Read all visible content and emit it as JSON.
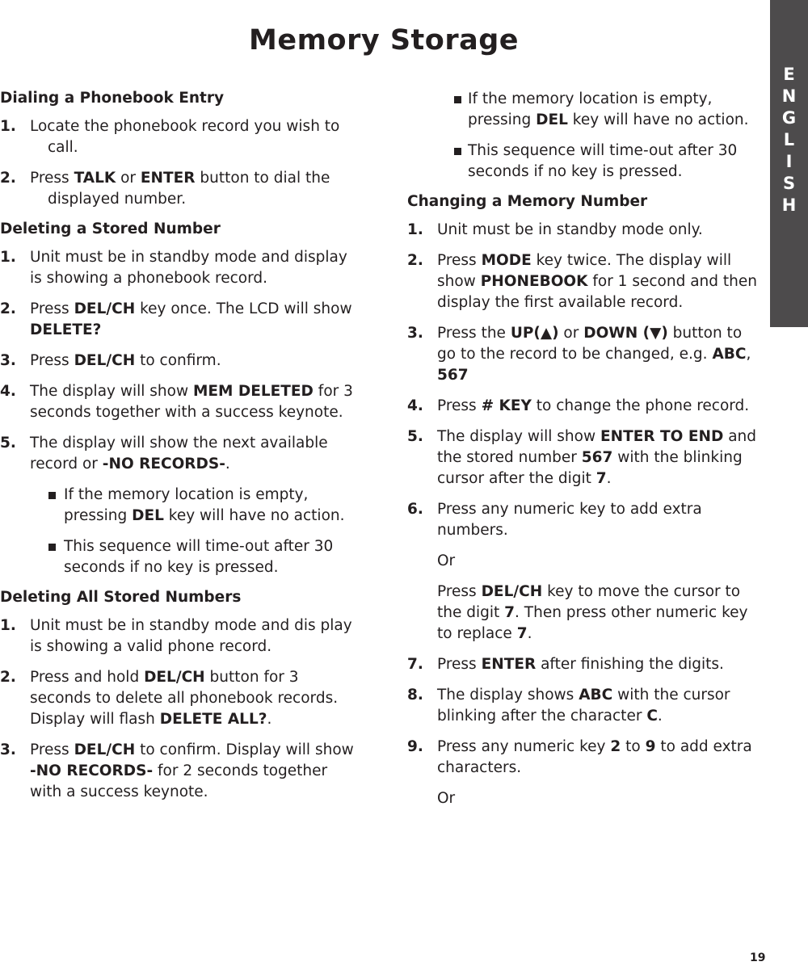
{
  "page": {
    "title": "Memory Storage",
    "page_number": "19",
    "language_tab": [
      "E",
      "N",
      "G",
      "L",
      "I",
      "S",
      "H"
    ],
    "colors": {
      "text": "#231f20",
      "tab_background": "#4d4b4c",
      "tab_text": "#ffffff"
    }
  },
  "left": {
    "dialing": {
      "heading": "Dialing a Phonebook Entry",
      "steps": [
        {
          "num": "1.",
          "segments": [
            [
              "Locate the phonebook record you wish to ",
              false
            ]
          ],
          "hang": [
            [
              "call.",
              false
            ]
          ]
        },
        {
          "num": "2.",
          "segments": [
            [
              "Press ",
              false
            ],
            [
              "TALK",
              true
            ],
            [
              " or ",
              false
            ],
            [
              "ENTER",
              true
            ],
            [
              " button to dial the",
              false
            ]
          ],
          "hang": [
            [
              "displayed number.",
              false
            ]
          ]
        }
      ]
    },
    "deleting": {
      "heading": "Deleting a Stored Number",
      "steps": [
        {
          "num": "1.",
          "segments": [
            [
              "Unit must be in standby mode and display is showing a phonebook record.",
              false
            ]
          ]
        },
        {
          "num": "2.",
          "segments": [
            [
              "Press ",
              false
            ],
            [
              "DEL/CH",
              true
            ],
            [
              " key once. The LCD will show ",
              false
            ],
            [
              "DELETE?",
              true
            ]
          ]
        },
        {
          "num": "3.",
          "segments": [
            [
              "Press ",
              false
            ],
            [
              "DEL/CH",
              true
            ],
            [
              " to confirm.",
              false
            ]
          ]
        },
        {
          "num": "4.",
          "segments": [
            [
              "The display will show ",
              false
            ],
            [
              "MEM DELETED",
              true
            ],
            [
              " for 3  seconds together with a success keynote.",
              false
            ]
          ]
        },
        {
          "num": "5.",
          "segments": [
            [
              "The display will show the next available record or ",
              false
            ],
            [
              "-NO RECORDS-",
              true
            ],
            [
              ".",
              false
            ]
          ]
        }
      ],
      "bullets": [
        {
          "segments": [
            [
              "If the memory location is empty, pressing ",
              false
            ],
            [
              "DEL",
              true
            ],
            [
              " key will have no action.",
              false
            ]
          ]
        },
        {
          "segments": [
            [
              "This sequence will time-out after 30 seconds if no key is pressed.",
              false
            ]
          ]
        }
      ]
    },
    "deleting_all": {
      "heading": "Deleting All Stored Numbers",
      "steps": [
        {
          "num": "1.",
          "segments": [
            [
              "Unit must be in standby mode and dis play is showing a valid phone record.",
              false
            ]
          ]
        },
        {
          "num": "2.",
          "segments": [
            [
              "Press and hold ",
              false
            ],
            [
              "DEL/CH",
              true
            ],
            [
              " button for 3 seconds to delete all phonebook records. Display will flash ",
              false
            ],
            [
              "DELETE ALL?",
              true
            ],
            [
              ".",
              false
            ]
          ]
        },
        {
          "num": "3.",
          "segments": [
            [
              "Press ",
              false
            ],
            [
              "DEL/CH",
              true
            ],
            [
              " to confirm. Display will show ",
              false
            ],
            [
              "-NO RECORDS-",
              true
            ],
            [
              " for 2 seconds together with a success keynote.",
              false
            ]
          ]
        }
      ]
    }
  },
  "right": {
    "bullets": [
      {
        "segments": [
          [
            "If the memory location is empty, pressing ",
            false
          ],
          [
            "DEL",
            true
          ],
          [
            " key will have no action.",
            false
          ]
        ]
      },
      {
        "segments": [
          [
            "This sequence will time-out after 30 seconds if no key is pressed.",
            false
          ]
        ]
      }
    ],
    "changing": {
      "heading": "Changing a Memory Number",
      "steps": [
        {
          "num": "1.",
          "segments": [
            [
              "Unit must be in standby mode only.",
              false
            ]
          ]
        },
        {
          "num": "2.",
          "segments": [
            [
              "Press ",
              false
            ],
            [
              "MODE",
              true
            ],
            [
              " key twice. The display will show ",
              false
            ],
            [
              "PHONEBOOK",
              true
            ],
            [
              " for 1 second and then display the first available record.",
              false
            ]
          ]
        },
        {
          "num": "3.",
          "segments": [
            [
              "Press the ",
              false
            ],
            [
              "UP(▲)",
              true
            ],
            [
              " or ",
              false
            ],
            [
              "DOWN (▼)",
              true
            ],
            [
              " button to go to the record to be changed, e.g. ",
              false
            ],
            [
              "ABC",
              true
            ],
            [
              ", ",
              false
            ],
            [
              "567",
              true
            ]
          ]
        },
        {
          "num": "4.",
          "segments": [
            [
              "Press ",
              false
            ],
            [
              "# KEY",
              true
            ],
            [
              " to change the phone record.",
              false
            ]
          ]
        },
        {
          "num": "5.",
          "segments": [
            [
              "The display will show ",
              false
            ],
            [
              "ENTER TO END",
              true
            ],
            [
              " and the stored number ",
              false
            ],
            [
              "567",
              true
            ],
            [
              " with the blinking cursor after the digit ",
              false
            ],
            [
              "7",
              true
            ],
            [
              ".",
              false
            ]
          ]
        },
        {
          "num": "6.",
          "segments": [
            [
              "Press any numeric key to add extra numbers.",
              false
            ]
          ]
        }
      ],
      "or_1": "Or",
      "alt_6": [
        [
          "Press ",
          false
        ],
        [
          "DEL/CH",
          true
        ],
        [
          " key to move the cursor to the digit ",
          false
        ],
        [
          "7",
          true
        ],
        [
          ". Then press other numeric key to replace ",
          false
        ],
        [
          "7",
          true
        ],
        [
          ".",
          false
        ]
      ],
      "steps_b": [
        {
          "num": "7.",
          "segments": [
            [
              "Press ",
              false
            ],
            [
              "ENTER",
              true
            ],
            [
              " after finishing the digits.",
              false
            ]
          ]
        },
        {
          "num": "8.",
          "segments": [
            [
              "The display shows ",
              false
            ],
            [
              "ABC",
              true
            ],
            [
              " with the cursor blinking after the character ",
              false
            ],
            [
              "C",
              true
            ],
            [
              ".",
              false
            ]
          ]
        },
        {
          "num": "9.",
          "segments": [
            [
              "Press any numeric key ",
              false
            ],
            [
              "2",
              true
            ],
            [
              " to ",
              false
            ],
            [
              "9",
              true
            ],
            [
              " to add extra characters.",
              false
            ]
          ]
        }
      ],
      "or_2": "Or"
    }
  }
}
